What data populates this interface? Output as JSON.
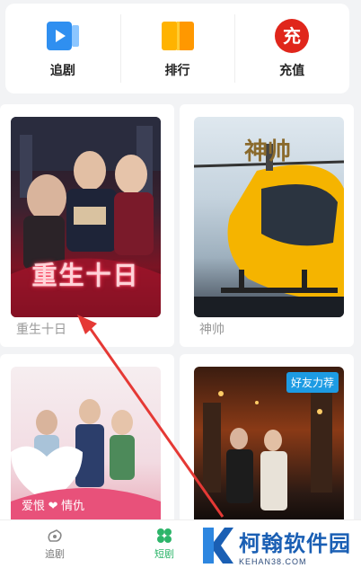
{
  "quick_bar": {
    "items": [
      {
        "label": "追剧",
        "icon": "play-video-icon"
      },
      {
        "label": "排行",
        "icon": "ranking-icon"
      },
      {
        "label": "充值",
        "icon": "recharge-icon",
        "icon_text": "充"
      }
    ]
  },
  "dramas": [
    {
      "title": "重生十日",
      "poster_text": "重生十日",
      "poster_icon": "poster-image"
    },
    {
      "title": "神帅",
      "poster_text": "神帅",
      "poster_icon": "helicopter-poster"
    },
    {
      "title": "",
      "poster_text": "爱恨 ❤ 情仇",
      "poster_icon": "couple-poster"
    },
    {
      "title": "",
      "poster_text": "",
      "badge": "好友力荐",
      "poster_icon": "night-city-poster"
    }
  ],
  "bottom_nav": {
    "items": [
      {
        "label": "追剧",
        "icon": "tv-icon"
      },
      {
        "label": "短剧",
        "icon": "clover-icon",
        "active": true
      }
    ]
  },
  "watermark": {
    "title": "柯翰软件园",
    "url": "KEHAN38.COM"
  },
  "colors": {
    "accent": "#1d9be3",
    "active_nav": "#2db56a",
    "annotation_arrow": "#e53935",
    "recharge": "#e0261b"
  }
}
